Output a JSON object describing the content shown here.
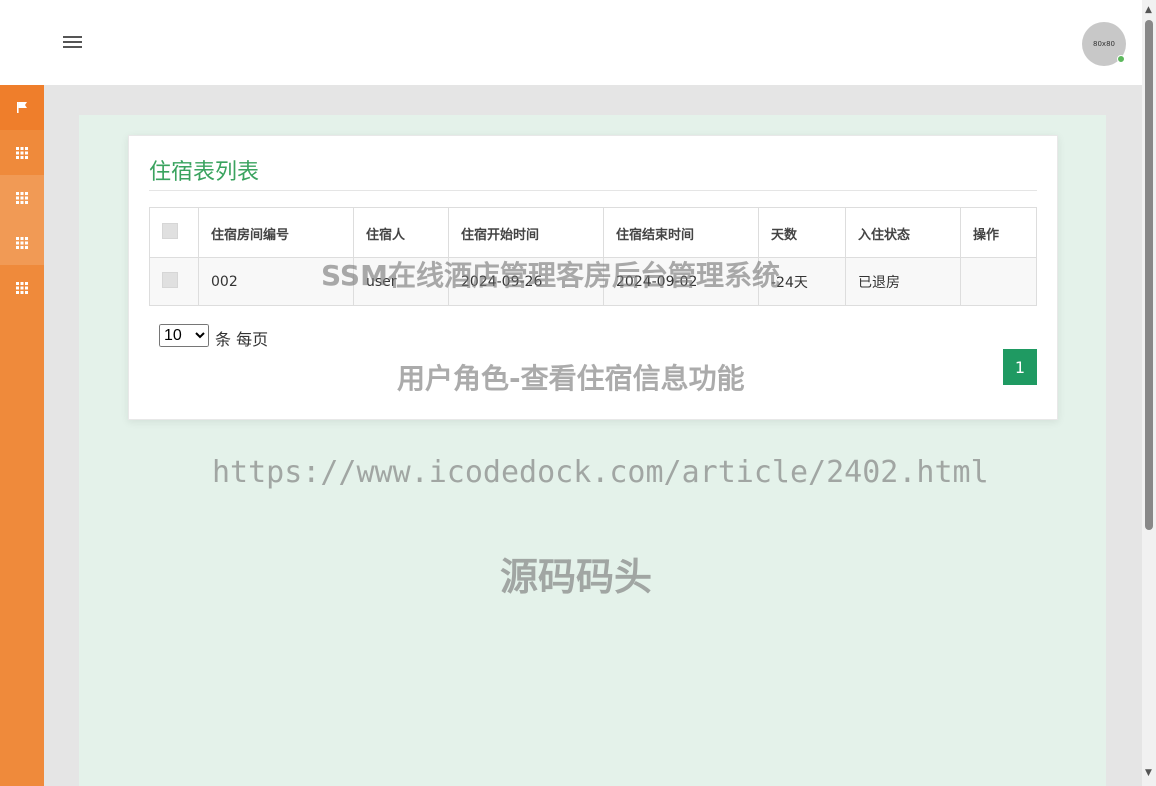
{
  "header": {
    "avatar_text": "80x80"
  },
  "sidebar": {
    "items": [
      {
        "icon": "flag-icon"
      },
      {
        "icon": "grid-icon"
      },
      {
        "icon": "grid-icon"
      },
      {
        "icon": "grid-icon"
      },
      {
        "icon": "grid-icon"
      }
    ]
  },
  "card": {
    "title": "住宿表列表",
    "columns": [
      "住宿房间编号",
      "住宿人",
      "住宿开始时间",
      "住宿结束时间",
      "天数",
      "入住状态",
      "操作"
    ],
    "rows": [
      {
        "room": "002",
        "guest": "user",
        "start": "2024-09-26",
        "end": "2024-09-02",
        "days": "-24天",
        "status": "已退房",
        "action": ""
      }
    ]
  },
  "pager": {
    "page_size": "10",
    "page_size_options": [
      "10"
    ],
    "suffix": "条 每页",
    "current_page": "1"
  },
  "watermarks": {
    "line1": "SSM在线酒店管理客房后台管理系统",
    "line2": "用户角色-查看住宿信息功能",
    "line3": "https://www.icodedock.com/article/2402.html",
    "line4": "源码码头"
  },
  "colors": {
    "sidebar": "#ef8a3b",
    "title": "#3aa35f",
    "page_button": "#1f9a62",
    "content_bg": "#e4f2ea"
  }
}
